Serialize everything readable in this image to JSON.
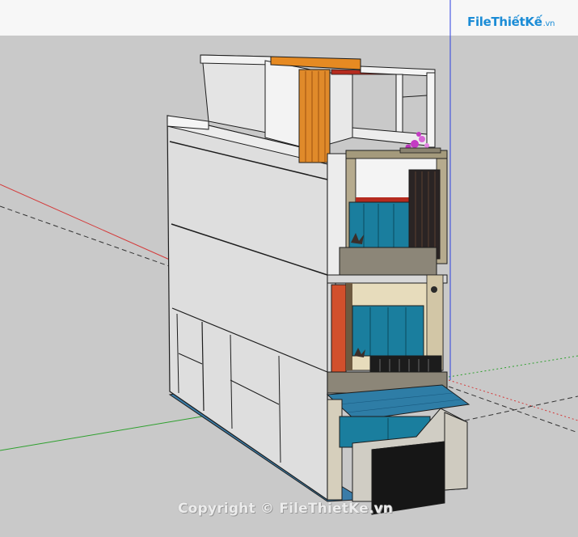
{
  "logo": {
    "label": "FileThiếtKế",
    "tld": ".vn"
  },
  "watermark": {
    "text": "Copyright © FileThietKe.vn"
  },
  "colors": {
    "background": "#c9c9c9",
    "sky": "#f7f7f7",
    "axis_red": "#d43a3a",
    "axis_green": "#2ea02e",
    "axis_blue": "#2b3fe0",
    "wall": "#dedede",
    "glass": "#1a7e9e",
    "timber": "#e08a2a",
    "garage_door": "#161616",
    "awning": "#2e7da6",
    "stone": "#8c8678"
  },
  "icons": [
    "filethietke-logo",
    "flowering-plant-icon",
    "potted-plant-icon"
  ]
}
